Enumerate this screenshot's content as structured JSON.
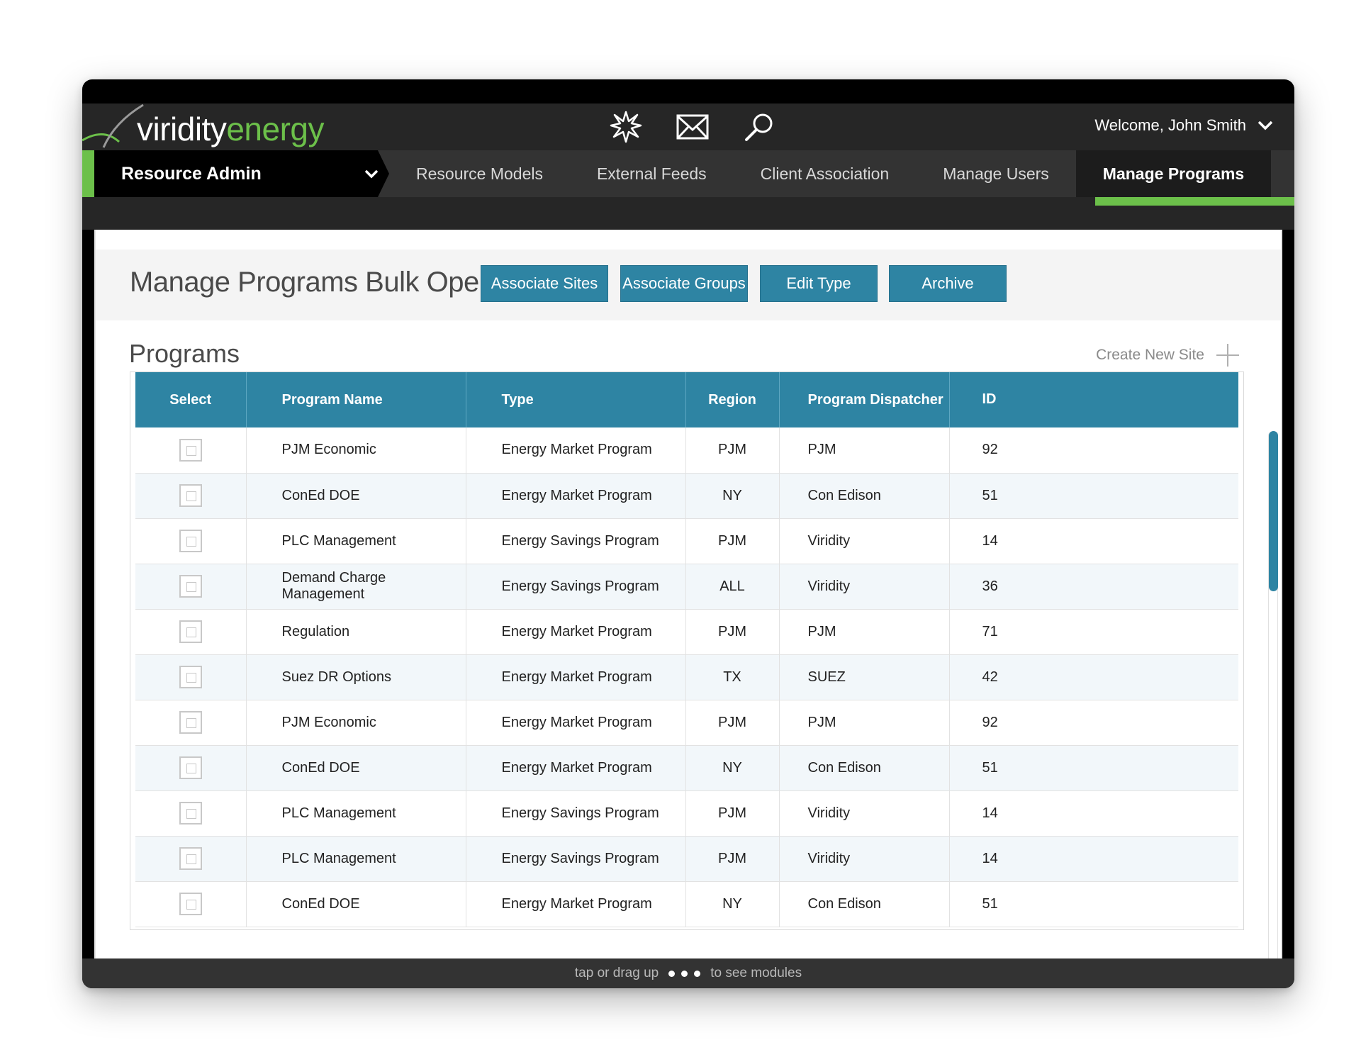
{
  "brand": {
    "part1": "viridity",
    "part2": "energy",
    "color_green": "#6cc04a",
    "color_teal": "#2e84a3"
  },
  "header": {
    "icons": [
      "notification-burst-icon",
      "mail-icon",
      "search-icon"
    ],
    "welcome": "Welcome, John Smith"
  },
  "nav": {
    "module": "Resource Admin",
    "tabs": [
      {
        "label": "Resource Models",
        "active": false
      },
      {
        "label": "External Feeds",
        "active": false
      },
      {
        "label": "Client Association",
        "active": false
      },
      {
        "label": "Manage Users",
        "active": false
      },
      {
        "label": "Manage Programs",
        "active": true
      }
    ]
  },
  "bulk": {
    "title": "Manage Programs Bulk Operations",
    "buttons": [
      "Associate Sites",
      "Associate Groups",
      "Edit Type",
      "Archive"
    ]
  },
  "programs": {
    "title": "Programs",
    "create_label": "Create New Site",
    "columns": [
      "Select",
      "Program Name",
      "Type",
      "Region",
      "Program Dispatcher",
      "ID"
    ],
    "rows": [
      {
        "name": "PJM Economic",
        "type": "Energy Market Program",
        "region": "PJM",
        "dispatcher": "PJM",
        "id": "92"
      },
      {
        "name": "ConEd DOE",
        "type": "Energy Market Program",
        "region": "NY",
        "dispatcher": "Con Edison",
        "id": "51"
      },
      {
        "name": "PLC Management",
        "type": "Energy Savings Program",
        "region": "PJM",
        "dispatcher": "Viridity",
        "id": "14"
      },
      {
        "name": "Demand Charge Management",
        "type": "Energy Savings Program",
        "region": "ALL",
        "dispatcher": "Viridity",
        "id": "36"
      },
      {
        "name": "Regulation",
        "type": "Energy Market Program",
        "region": "PJM",
        "dispatcher": "PJM",
        "id": "71"
      },
      {
        "name": "Suez DR Options",
        "type": "Energy Market Program",
        "region": "TX",
        "dispatcher": "SUEZ",
        "id": "42"
      },
      {
        "name": "PJM Economic",
        "type": "Energy Market Program",
        "region": "PJM",
        "dispatcher": "PJM",
        "id": "92"
      },
      {
        "name": "ConEd DOE",
        "type": "Energy Market Program",
        "region": "NY",
        "dispatcher": "Con Edison",
        "id": "51"
      },
      {
        "name": "PLC Management",
        "type": "Energy Savings Program",
        "region": "PJM",
        "dispatcher": "Viridity",
        "id": "14"
      },
      {
        "name": "PLC Management",
        "type": "Energy Savings Program",
        "region": "PJM",
        "dispatcher": "Viridity",
        "id": "14"
      },
      {
        "name": "ConEd DOE",
        "type": "Energy Market Program",
        "region": "NY",
        "dispatcher": "Con Edison",
        "id": "51"
      }
    ]
  },
  "footer": {
    "before": "tap or drag up",
    "after": "to see modules"
  }
}
